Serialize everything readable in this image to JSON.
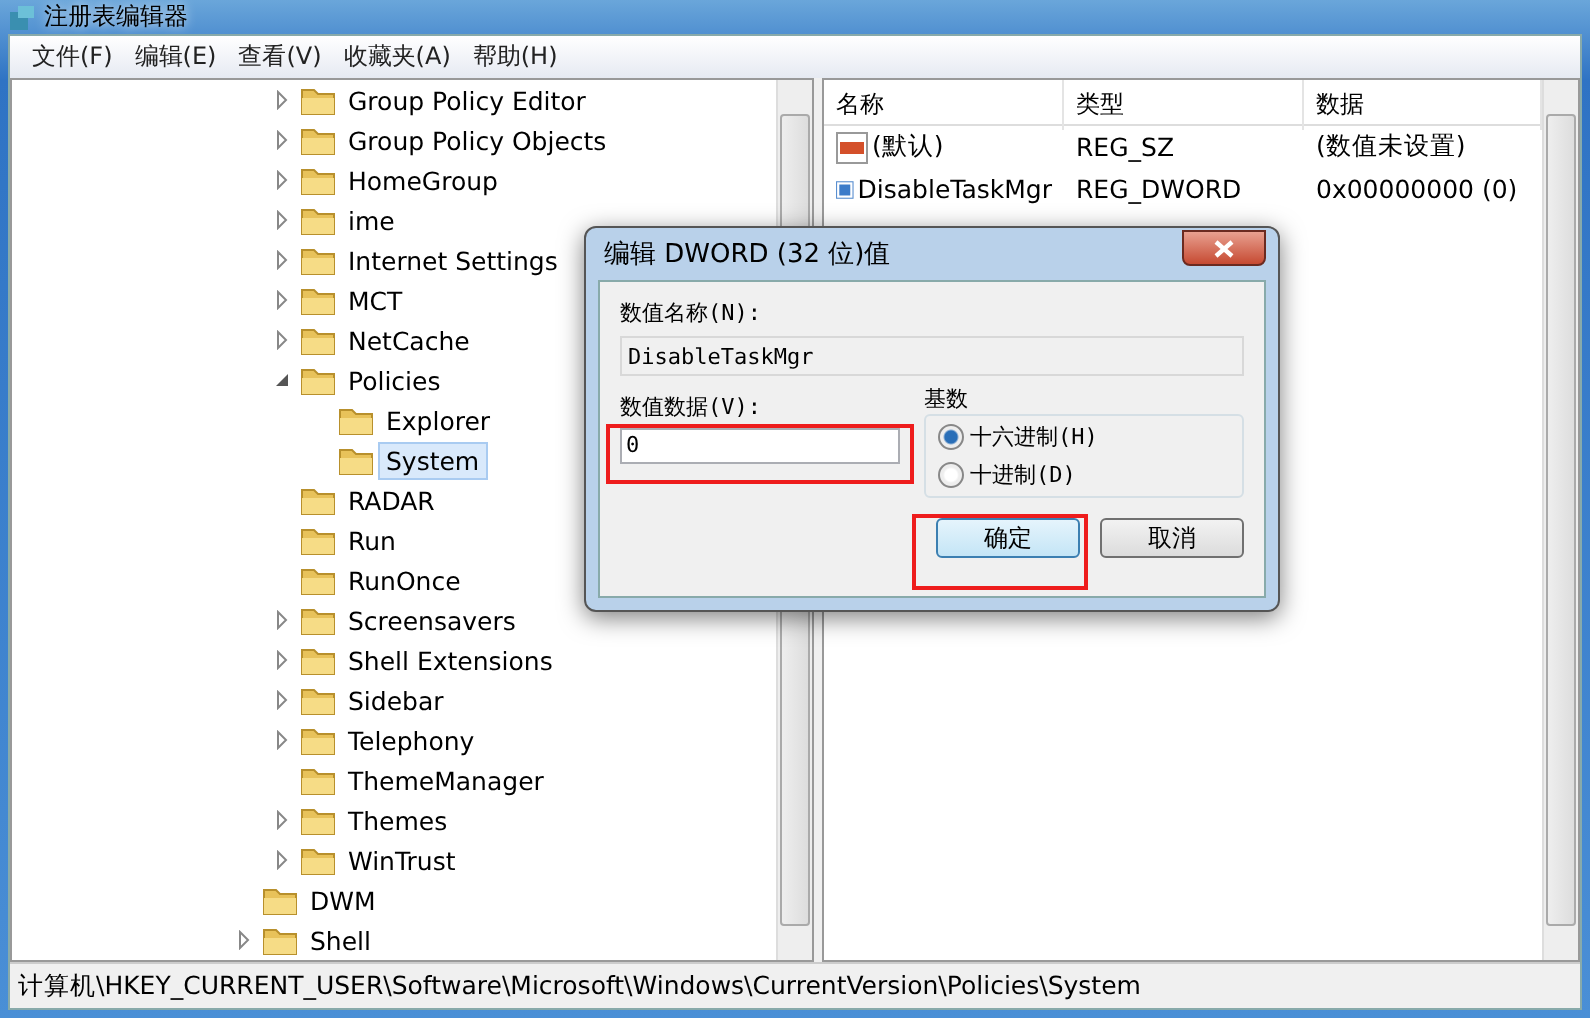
{
  "window": {
    "title": "注册表编辑器"
  },
  "menu": [
    "文件(F)",
    "编辑(E)",
    "查看(V)",
    "收藏夹(A)",
    "帮助(H)"
  ],
  "tree": {
    "inner_items": [
      {
        "label": "Group Policy Editor",
        "expandable": true,
        "expanded": false,
        "selected": false
      },
      {
        "label": "Group Policy Objects",
        "expandable": true,
        "expanded": false,
        "selected": false
      },
      {
        "label": "HomeGroup",
        "expandable": true,
        "expanded": false,
        "selected": false
      },
      {
        "label": "ime",
        "expandable": true,
        "expanded": false,
        "selected": false
      },
      {
        "label": "Internet Settings",
        "expandable": true,
        "expanded": false,
        "selected": false
      },
      {
        "label": "MCT",
        "expandable": true,
        "expanded": false,
        "selected": false
      },
      {
        "label": "NetCache",
        "expandable": true,
        "expanded": false,
        "selected": false
      },
      {
        "label": "Policies",
        "expandable": true,
        "expanded": true,
        "selected": false,
        "children": [
          {
            "label": "Explorer",
            "expandable": false,
            "selected": false
          },
          {
            "label": "System",
            "expandable": false,
            "selected": true
          }
        ]
      },
      {
        "label": "RADAR",
        "expandable": false,
        "selected": false
      },
      {
        "label": "Run",
        "expandable": false,
        "selected": false
      },
      {
        "label": "RunOnce",
        "expandable": false,
        "selected": false
      },
      {
        "label": "Screensavers",
        "expandable": true,
        "expanded": false,
        "selected": false
      },
      {
        "label": "Shell Extensions",
        "expandable": true,
        "expanded": false,
        "selected": false
      },
      {
        "label": "Sidebar",
        "expandable": true,
        "expanded": false,
        "selected": false
      },
      {
        "label": "Telephony",
        "expandable": true,
        "expanded": false,
        "selected": false
      },
      {
        "label": "ThemeManager",
        "expandable": false,
        "selected": false
      },
      {
        "label": "Themes",
        "expandable": true,
        "expanded": false,
        "selected": false
      },
      {
        "label": "WinTrust",
        "expandable": true,
        "expanded": false,
        "selected": false
      }
    ],
    "outer_items": [
      {
        "label": "DWM",
        "expandable": false,
        "selected": false
      },
      {
        "label": "Shell",
        "expandable": true,
        "expanded": false,
        "selected": false
      }
    ]
  },
  "values_table": {
    "columns": [
      "名称",
      "类型",
      "数据"
    ],
    "rows": [
      {
        "kind": "string",
        "name": "(默认)",
        "type": "REG_SZ",
        "data": "(数值未设置)"
      },
      {
        "kind": "binary",
        "name": "DisableTaskMgr",
        "type": "REG_DWORD",
        "data": "0x00000000 (0)"
      }
    ]
  },
  "dialog": {
    "title": "编辑 DWORD (32 位)值",
    "name_label": "数值名称(N):",
    "name_value": "DisableTaskMgr",
    "data_label": "数值数据(V):",
    "data_value": "0",
    "base_label": "基数",
    "bases": [
      {
        "label": "十六进制(H)",
        "selected": true
      },
      {
        "label": "十进制(D)",
        "selected": false
      }
    ],
    "buttons": [
      {
        "label": "确定",
        "default": true
      },
      {
        "label": "取消",
        "default": false
      }
    ]
  },
  "status_bar": "计算机\\HKEY_CURRENT_USER\\Software\\Microsoft\\Windows\\CurrentVersion\\Policies\\System"
}
